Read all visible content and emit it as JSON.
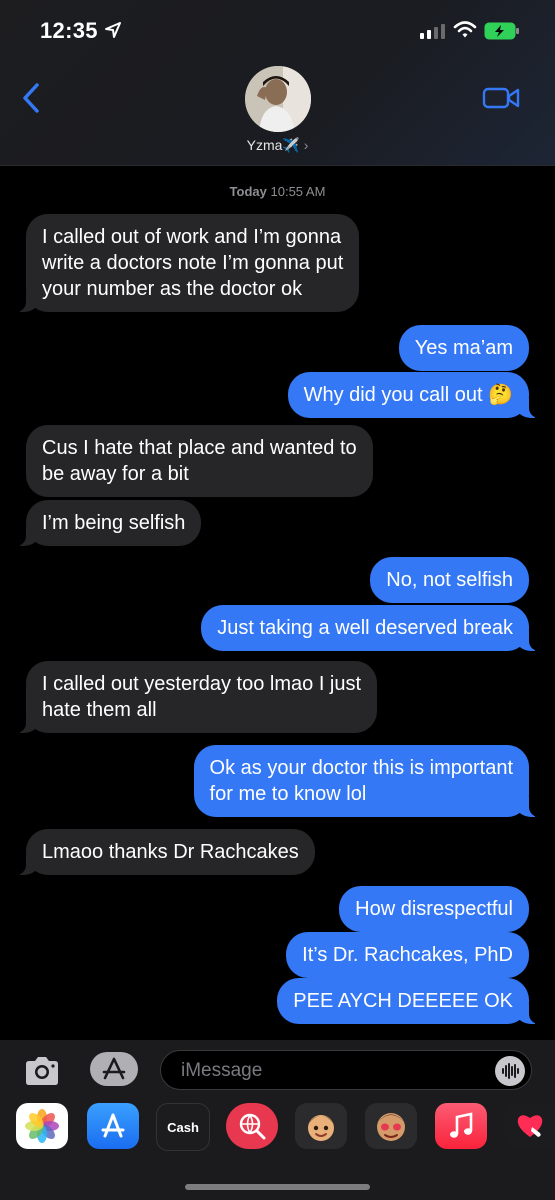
{
  "status_bar": {
    "time": "12:35"
  },
  "contact": {
    "name": "Yzma✈️"
  },
  "timestamp": {
    "day": "Today",
    "time": "10:55 AM"
  },
  "messages": [
    {
      "from": "them",
      "lines": [
        "I called out of work and I’m gonna",
        "write a doctors note I’m gonna put",
        "your number as the doctor ok"
      ]
    },
    {
      "from": "me",
      "lines": [
        "Yes ma’am"
      ]
    },
    {
      "from": "me",
      "lines": [
        "Why did you call out 🤔"
      ]
    },
    {
      "from": "them",
      "lines": [
        "Cus I hate that place and wanted to",
        "be away for a bit"
      ]
    },
    {
      "from": "them",
      "lines": [
        "I’m being selfish"
      ]
    },
    {
      "from": "me",
      "lines": [
        "No, not selfish"
      ]
    },
    {
      "from": "me",
      "lines": [
        "Just taking a well deserved break"
      ]
    },
    {
      "from": "them",
      "lines": [
        "I called out yesterday too lmao I just",
        "hate them all"
      ]
    },
    {
      "from": "me",
      "lines": [
        "Ok as your doctor this is important",
        "for me to know lol"
      ]
    },
    {
      "from": "them",
      "lines": [
        "Lmaoo thanks Dr Rachcakes"
      ]
    },
    {
      "from": "me",
      "lines": [
        "How disrespectful"
      ]
    },
    {
      "from": "me",
      "lines": [
        "It’s Dr. Rachcakes, PhD"
      ]
    },
    {
      "from": "me",
      "lines": [
        "PEE AYCH DEEEEE OK"
      ]
    }
  ],
  "composer": {
    "placeholder": "iMessage"
  },
  "app_strip": [
    {
      "name": "photos-app-icon"
    },
    {
      "name": "app-store-icon"
    },
    {
      "name": "apple-cash-icon",
      "label": "Cash"
    },
    {
      "name": "web-search-icon"
    },
    {
      "name": "memoji-icon"
    },
    {
      "name": "memoji-stickers-icon"
    },
    {
      "name": "music-icon"
    },
    {
      "name": "digital-touch-icon"
    }
  ],
  "colors": {
    "outgoing": "#3478f6",
    "incoming": "#262628",
    "background": "#000000"
  }
}
